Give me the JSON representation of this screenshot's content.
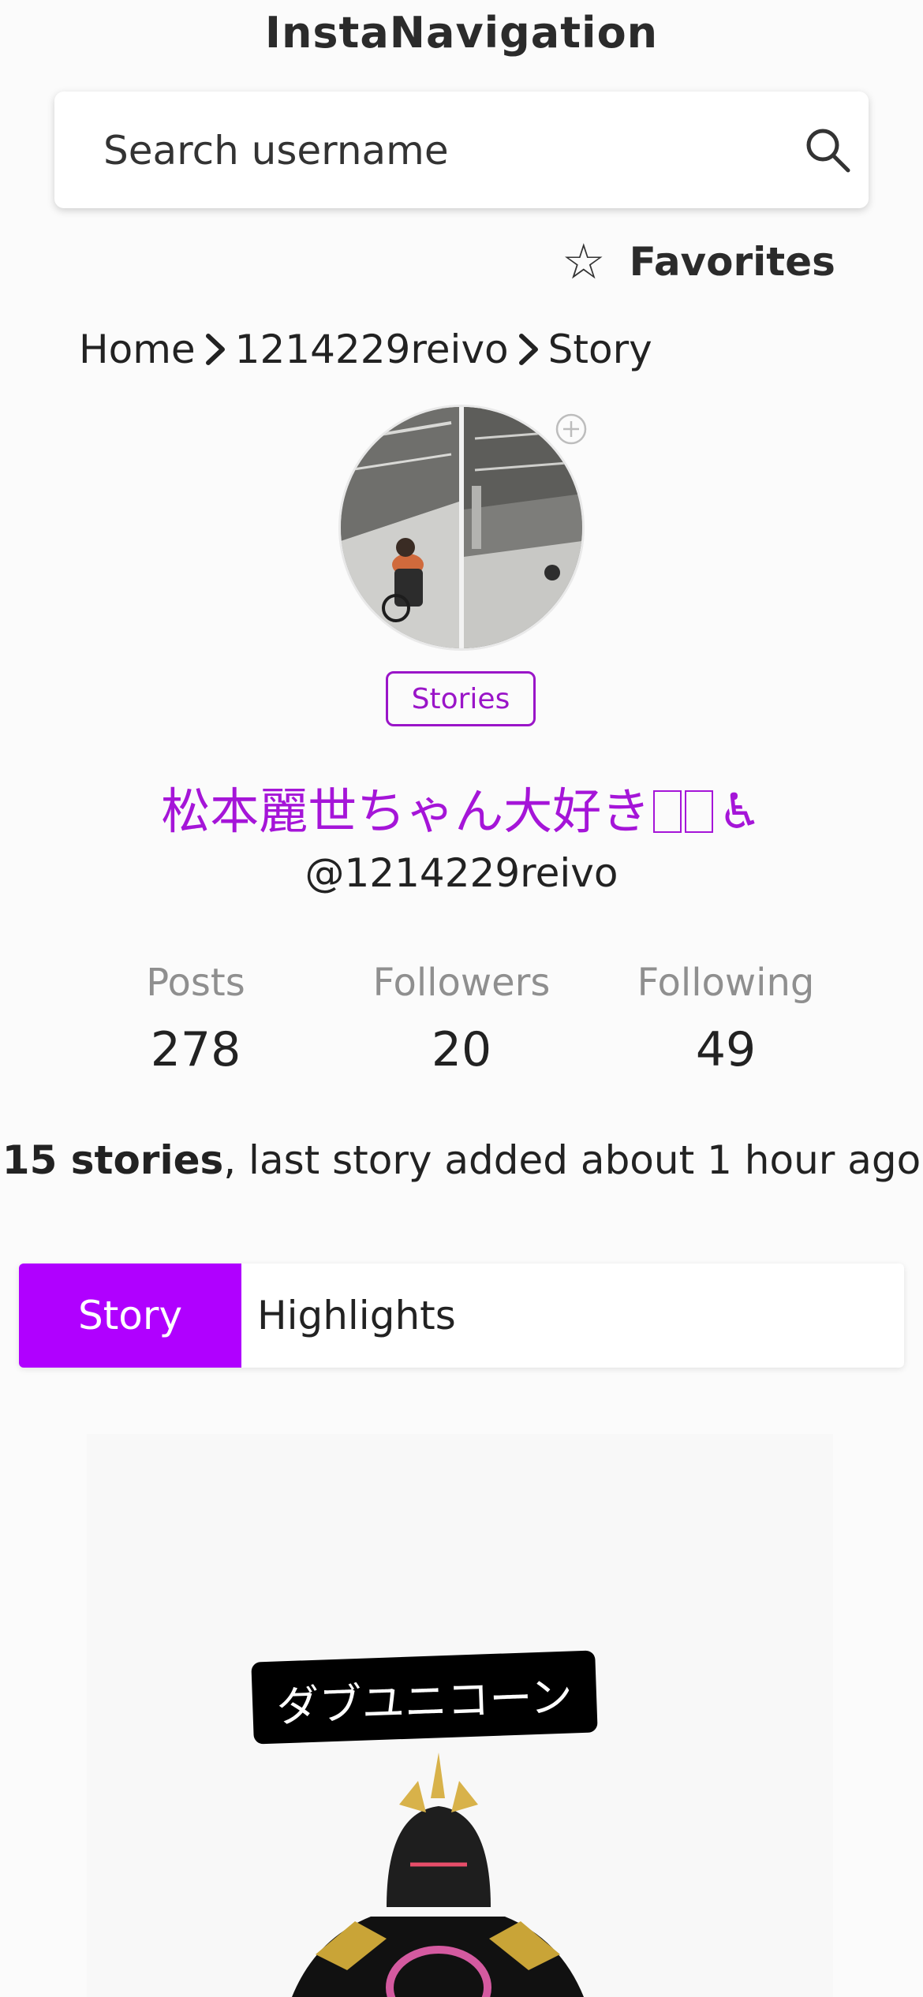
{
  "app": {
    "title": "InstaNavigation"
  },
  "search": {
    "placeholder": "Search username",
    "icon": "search-icon"
  },
  "favorites": {
    "icon": "star-outline-icon",
    "label": "Favorites"
  },
  "breadcrumb": {
    "items": [
      "Home",
      "1214229reivo",
      "Story"
    ],
    "separator_icon": "chevron-right-icon"
  },
  "profile": {
    "stories_badge": "Stories",
    "display_name": "松本麗世ちゃん大好き",
    "display_name_icon": "wheelchair-icon",
    "username": "@1214229reivo",
    "add_icon": "plus-circle-icon"
  },
  "stats": [
    {
      "label": "Posts",
      "value": "278"
    },
    {
      "label": "Followers",
      "value": "20"
    },
    {
      "label": "Following",
      "value": "49"
    }
  ],
  "stories_summary": {
    "count_text": "15 stories",
    "rest_text": ", last story added about 1 hour ago"
  },
  "tabs": {
    "active": "Story",
    "items": [
      "Story",
      "Highlights"
    ]
  },
  "story": {
    "caption": "ダブユニコーン"
  },
  "colors": {
    "accent": "#b000ff",
    "name": "#a515d8",
    "badge": "#9a15c8",
    "muted": "#8f8f8f"
  }
}
